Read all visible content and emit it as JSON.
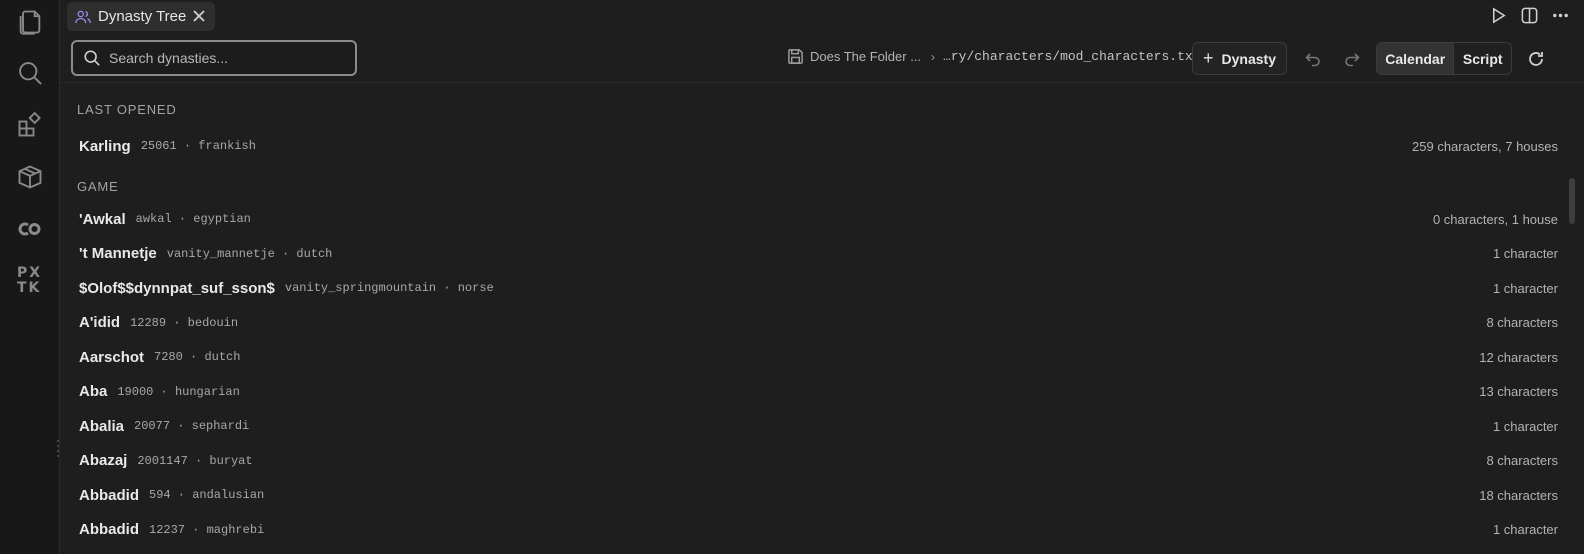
{
  "activity_bar": {
    "icons": [
      "files-icon",
      "search-icon",
      "extensions-icon",
      "package-icon",
      "co-icon",
      "pxtk-icon"
    ],
    "pxtk_text": "PX TK"
  },
  "tab": {
    "label": "Dynasty Tree",
    "icon": "users-icon",
    "accent": "#a78bfa"
  },
  "title_actions": [
    "run-icon",
    "split-editor-icon",
    "more-icon"
  ],
  "toolbar": {
    "search_placeholder": "Search dynasties...",
    "breadcrumb_folder": "Does The Folder ...",
    "breadcrumb_separator": "›",
    "breadcrumb_path": "…ry/characters/mod_characters.txt",
    "add_dynasty_plus": "+",
    "add_dynasty_label": "Dynasty",
    "view_calendar": "Calendar",
    "view_script": "Script"
  },
  "sections": {
    "last_opened": "LAST OPENED",
    "game": "GAME"
  },
  "last_opened": [
    {
      "name": "Karling",
      "meta": "25061 · frankish",
      "count": "259 characters, 7 houses"
    }
  ],
  "game": [
    {
      "name": "'Awkal",
      "meta": "awkal · egyptian",
      "count": "0 characters, 1 house"
    },
    {
      "name": "'t Mannetje",
      "meta": "vanity_mannetje · dutch",
      "count": "1 character"
    },
    {
      "name": "$Olof$$dynnpat_suf_sson$",
      "meta": "vanity_springmountain · norse",
      "count": "1 character"
    },
    {
      "name": "A'idid",
      "meta": "12289 · bedouin",
      "count": "8 characters"
    },
    {
      "name": "Aarschot",
      "meta": "7280 · dutch",
      "count": "12 characters"
    },
    {
      "name": "Aba",
      "meta": "19000 · hungarian",
      "count": "13 characters"
    },
    {
      "name": "Abalia",
      "meta": "20077 · sephardi",
      "count": "1 character"
    },
    {
      "name": "Abazaj",
      "meta": "2001147 · buryat",
      "count": "8 characters"
    },
    {
      "name": "Abbadid",
      "meta": "594 · andalusian",
      "count": "18 characters"
    },
    {
      "name": "Abbadid",
      "meta": "12237 · maghrebi",
      "count": "1 character"
    }
  ]
}
